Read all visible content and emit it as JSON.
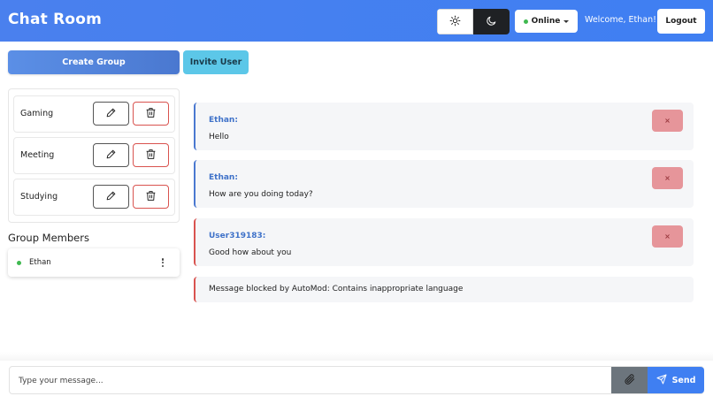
{
  "header": {
    "title": "Chat Room",
    "status": {
      "label": "Online",
      "dot_color": "#3fb950"
    },
    "welcome": "Welcome, Ethan!",
    "logout_label": "Logout",
    "theme": {
      "light_icon": "sun-icon",
      "dark_icon": "moon-icon",
      "active": "dark"
    }
  },
  "actions": {
    "create_group_label": "Create Group",
    "invite_user_label": "Invite User"
  },
  "groups": [
    {
      "name": "Gaming"
    },
    {
      "name": "Meeting"
    },
    {
      "name": "Studying"
    }
  ],
  "members": {
    "title": "Group Members",
    "items": [
      {
        "name": "Ethan",
        "status_color": "#3fb950"
      }
    ]
  },
  "messages": [
    {
      "sender": "Ethan:",
      "text": "Hello",
      "accent": "#4a78d0",
      "delete_label": "×"
    },
    {
      "sender": "Ethan:",
      "text": "How are you doing today?",
      "accent": "#4a78d0",
      "delete_label": "×"
    },
    {
      "sender": "User319183:",
      "text": "Good how about you",
      "accent": "#d9534f",
      "delete_label": "×"
    },
    {
      "text": "Message blocked by AutoMod: Contains inappropriate language",
      "accent": "#d9534f"
    }
  ],
  "composer": {
    "placeholder": "Type your message...",
    "attach_icon": "paperclip-icon",
    "send_label": "Send",
    "send_icon": "send-icon"
  },
  "colors": {
    "header_blue": "#3f7ff2",
    "delete_red": "#d9534f",
    "info_cyan": "#5cc7e8"
  }
}
